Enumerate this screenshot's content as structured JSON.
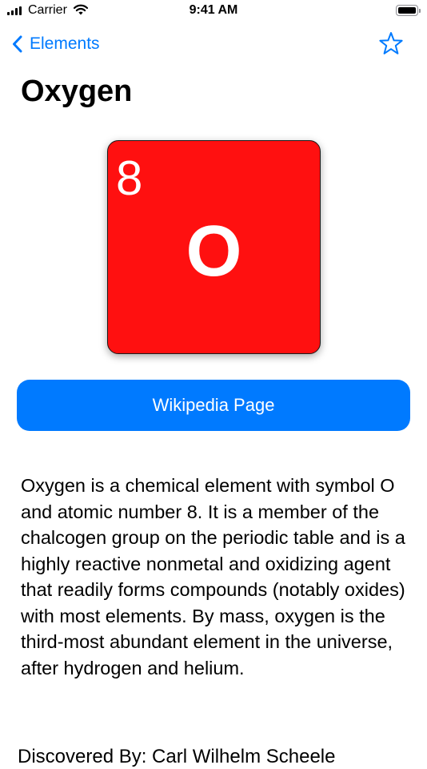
{
  "status_bar": {
    "carrier": "Carrier",
    "time": "9:41 AM",
    "icons": [
      "signal-icon",
      "wifi-icon",
      "battery-icon"
    ]
  },
  "nav": {
    "back_label": "Elements",
    "back_icon": "chevron-left-icon",
    "favorite_icon": "star-outline-icon",
    "accent_color": "#007aff"
  },
  "element": {
    "name": "Oxygen",
    "atomic_number": "8",
    "symbol": "O",
    "tile_color": "#ff1010"
  },
  "wikipedia_button": {
    "label": "Wikipedia Page",
    "color": "#007aff"
  },
  "summary": "Oxygen is a chemical element with symbol O and atomic number 8. It is a member of the chalcogen group on the periodic table and is a highly reactive nonmetal and oxidizing agent that readily forms compounds (notably oxides) with most elements. By mass, oxygen is the third-most abundant element in the universe, after hydrogen and helium.",
  "discovered_by": "Discovered By: Carl Wilhelm Scheele"
}
